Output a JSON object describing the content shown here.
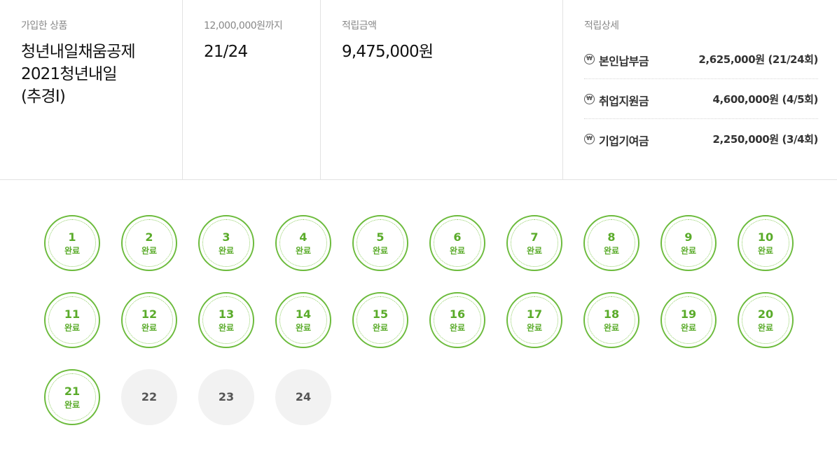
{
  "summary": {
    "product": {
      "label": "가입한 상품",
      "lines": [
        "청년내일채움공제",
        "2021청년내일",
        "(추경Ⅰ)"
      ]
    },
    "progress": {
      "label": "12,000,000원까지",
      "value": "21/24"
    },
    "amount": {
      "label": "적립금액",
      "value": "9,475,000원"
    },
    "detail": {
      "label": "적립상세",
      "icon": "won-icon",
      "icon_glyph": "₩",
      "rows": [
        {
          "name": "본인납부금",
          "value": "2,625,000원 (21/24회)"
        },
        {
          "name": "취업지원금",
          "value": "4,600,000원 (4/5회)"
        },
        {
          "name": "기업기여금",
          "value": "2,250,000원 (3/4회)"
        }
      ]
    }
  },
  "stamps": {
    "done_label": "완료",
    "accent_color": "#6cbb3c",
    "pending_color": "#f2f2f2",
    "items": [
      {
        "number": "1",
        "done": true
      },
      {
        "number": "2",
        "done": true
      },
      {
        "number": "3",
        "done": true
      },
      {
        "number": "4",
        "done": true
      },
      {
        "number": "5",
        "done": true
      },
      {
        "number": "6",
        "done": true
      },
      {
        "number": "7",
        "done": true
      },
      {
        "number": "8",
        "done": true
      },
      {
        "number": "9",
        "done": true
      },
      {
        "number": "10",
        "done": true
      },
      {
        "number": "11",
        "done": true
      },
      {
        "number": "12",
        "done": true
      },
      {
        "number": "13",
        "done": true
      },
      {
        "number": "14",
        "done": true
      },
      {
        "number": "15",
        "done": true
      },
      {
        "number": "16",
        "done": true
      },
      {
        "number": "17",
        "done": true
      },
      {
        "number": "18",
        "done": true
      },
      {
        "number": "19",
        "done": true
      },
      {
        "number": "20",
        "done": true
      },
      {
        "number": "21",
        "done": true
      },
      {
        "number": "22",
        "done": false
      },
      {
        "number": "23",
        "done": false
      },
      {
        "number": "24",
        "done": false
      }
    ]
  }
}
